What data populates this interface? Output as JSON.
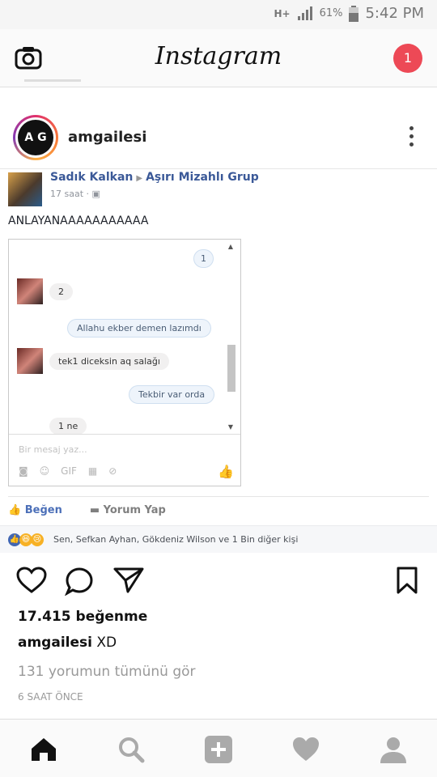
{
  "status_bar": {
    "network": "H+",
    "battery": "61%",
    "time": "5:42 PM"
  },
  "header": {
    "title": "Instagram",
    "notification_count": "1"
  },
  "post": {
    "username": "amgailesi",
    "avatar_text": "A G"
  },
  "fb_post": {
    "author": "Sadık Kalkan",
    "group": "Aşırı Mizahlı Grup",
    "time": "17 saat",
    "text": "ANLAYANAAAAAAAAAAA",
    "messages": [
      {
        "text": "1",
        "from": "me"
      },
      {
        "text": "2",
        "from": "other"
      },
      {
        "text": "Allahu ekber demen lazımdı",
        "from": "me"
      },
      {
        "text": "tek1 diceksin aq salağı",
        "from": "other"
      },
      {
        "text": "Tekbir var orda",
        "from": "me"
      },
      {
        "text": "1 ne",
        "from": "other"
      }
    ],
    "input_placeholder": "Bir mesaj yaz...",
    "gif_label": "GIF",
    "like_label": "Beğen",
    "comment_label": "Yorum Yap",
    "reactions_text": "Sen, Sefkan Ayhan, Gökdeniz Wilson ve 1 Bin diğer kişi"
  },
  "ig": {
    "likes": "17.415 beğenme",
    "caption_user": "amgailesi",
    "caption_text": "XD",
    "view_comments": "131 yorumun tümünü gör",
    "time_ago": "6 SAAT ÖNCE"
  },
  "icons": {
    "camera": "camera-icon",
    "heart": "heart-icon",
    "comment": "comment-icon",
    "share": "send-icon",
    "bookmark": "bookmark-icon",
    "home": "home-icon",
    "search": "search-icon",
    "add": "add-icon",
    "activity": "heart-outline-icon",
    "profile": "profile-icon"
  },
  "colors": {
    "badge": "#ed4956",
    "facebook_blue": "#3b5998"
  }
}
